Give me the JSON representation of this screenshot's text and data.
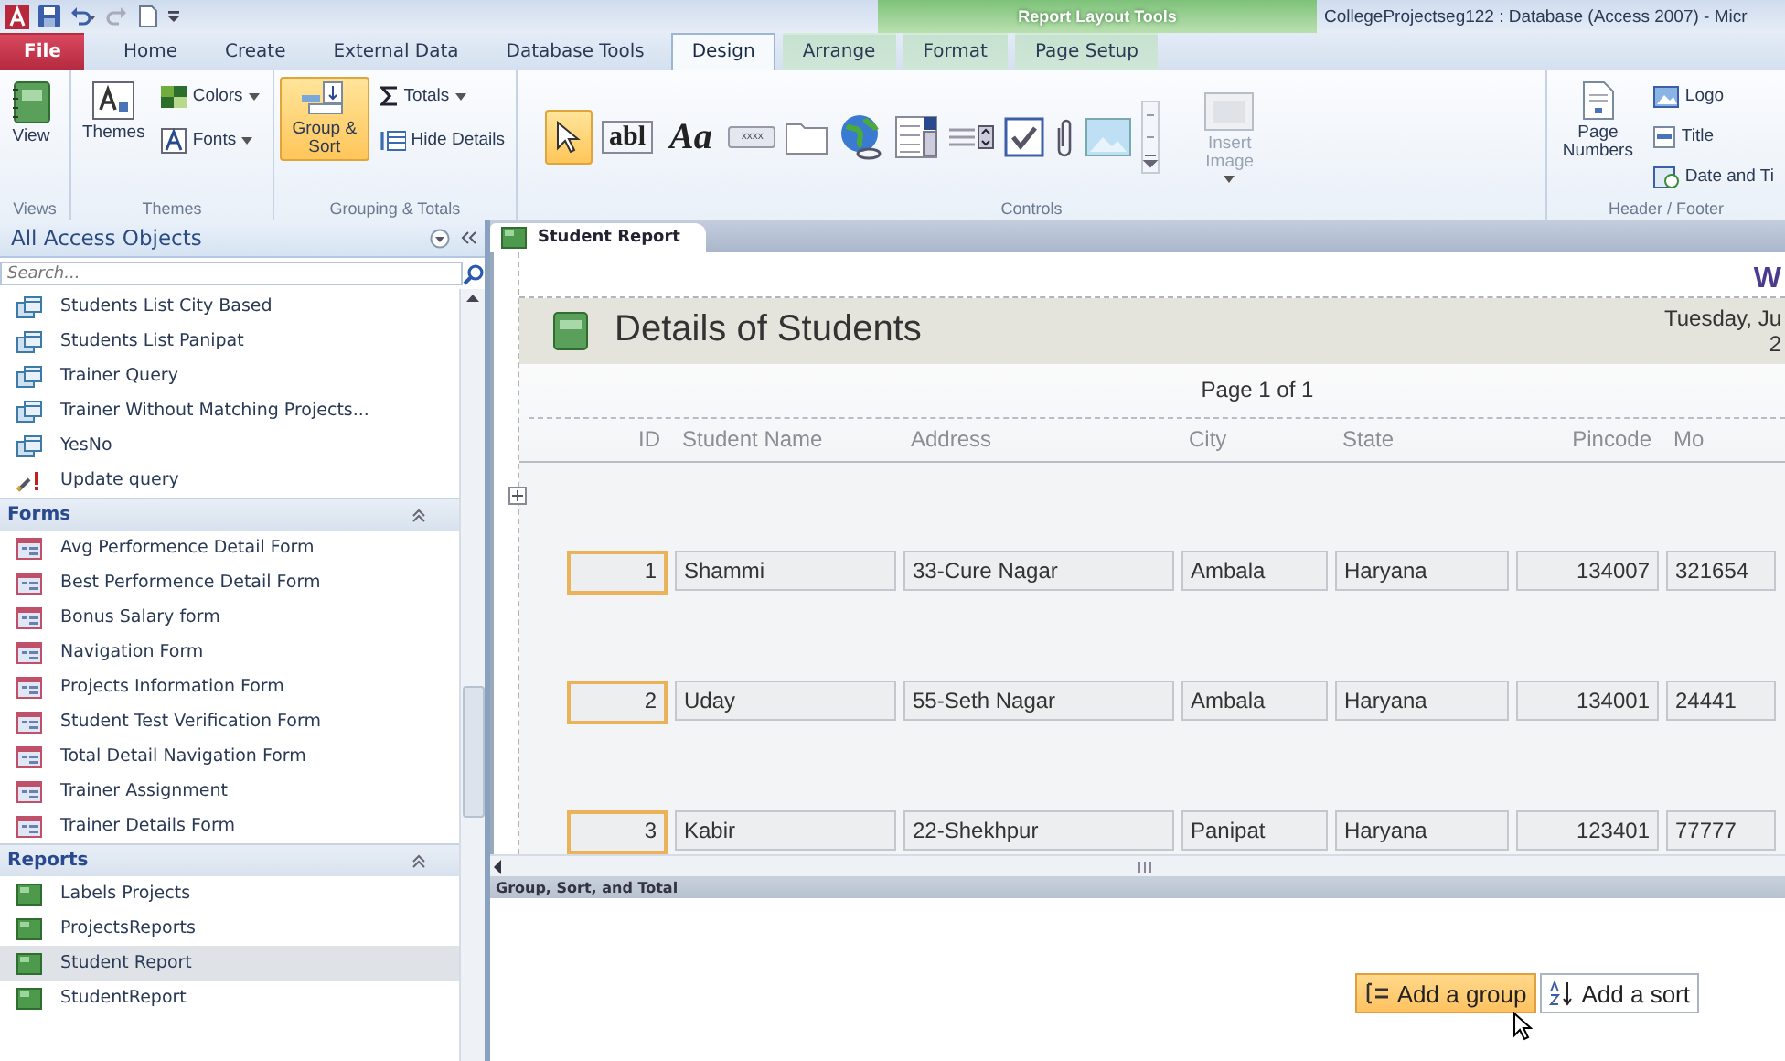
{
  "title_bar": {
    "contextual_group": "Report Layout Tools",
    "title": "CollegeProjectseg122 : Database (Access 2007) - Micr"
  },
  "ribbon_tabs": [
    {
      "label": "File",
      "kind": "file",
      "selected": false
    },
    {
      "label": "Home",
      "kind": "main",
      "selected": false
    },
    {
      "label": "Create",
      "kind": "main",
      "selected": false
    },
    {
      "label": "External Data",
      "kind": "main",
      "selected": false
    },
    {
      "label": "Database Tools",
      "kind": "main",
      "selected": false
    },
    {
      "label": "Design",
      "kind": "contextual",
      "selected": true
    },
    {
      "label": "Arrange",
      "kind": "contextual",
      "selected": false
    },
    {
      "label": "Format",
      "kind": "contextual",
      "selected": false
    },
    {
      "label": "Page Setup",
      "kind": "contextual",
      "selected": false
    }
  ],
  "ribbon": {
    "views": {
      "view_button": "View",
      "group_label": "Views"
    },
    "themes": {
      "themes_button": "Themes",
      "colors_button": "Colors",
      "fonts_button": "Fonts",
      "group_label": "Themes"
    },
    "grouping_totals": {
      "group_sort_button": {
        "label": "Group & Sort",
        "selected": true
      },
      "totals_button": "Totals",
      "hide_details_button": "Hide Details",
      "group_label": "Grouping & Totals"
    },
    "controls": {
      "select_tool_selected": true,
      "text_box_glyph": "abl",
      "label_glyph": "Aa",
      "button_glyph": "xxxx",
      "insert_image": {
        "label": "Insert Image",
        "disabled": true
      },
      "group_label": "Controls"
    },
    "header_footer": {
      "page_numbers_button": "Page Numbers",
      "logo_button": "Logo",
      "title_button": "Title",
      "date_time_button": "Date and Ti",
      "group_label": "Header / Footer"
    }
  },
  "navigation_pane": {
    "title": "All Access Objects",
    "search": {
      "placeholder": "Search..."
    },
    "sections": [
      {
        "items": [
          {
            "label": "Students List City Based",
            "kind": "query",
            "selected": false
          },
          {
            "label": "Students List Panipat",
            "kind": "query",
            "selected": false
          },
          {
            "label": "Trainer Query",
            "kind": "query",
            "selected": false
          },
          {
            "label": "Trainer Without Matching Projects...",
            "kind": "query",
            "selected": false
          },
          {
            "label": "YesNo",
            "kind": "query",
            "selected": false
          },
          {
            "label": "Update query",
            "kind": "update",
            "selected": false
          }
        ]
      },
      {
        "header": "Forms",
        "expanded": true,
        "items": [
          {
            "label": "Avg Performence Detail Form",
            "kind": "form",
            "selected": false
          },
          {
            "label": "Best Performence Detail Form",
            "kind": "form",
            "selected": false
          },
          {
            "label": "Bonus Salary form",
            "kind": "form",
            "selected": false
          },
          {
            "label": "Navigation Form",
            "kind": "form",
            "selected": false
          },
          {
            "label": "Projects Information Form",
            "kind": "form",
            "selected": false
          },
          {
            "label": "Student Test Verification Form",
            "kind": "form",
            "selected": false
          },
          {
            "label": "Total Detail Navigation Form",
            "kind": "form",
            "selected": false
          },
          {
            "label": "Trainer Assignment",
            "kind": "form",
            "selected": false
          },
          {
            "label": "Trainer Details Form",
            "kind": "form",
            "selected": false
          }
        ]
      },
      {
        "header": "Reports",
        "expanded": true,
        "items": [
          {
            "label": "Labels Projects",
            "kind": "report",
            "selected": false
          },
          {
            "label": "ProjectsReports",
            "kind": "report",
            "selected": false
          },
          {
            "label": "Student Report",
            "kind": "report",
            "selected": true
          },
          {
            "label": "StudentReport",
            "kind": "report",
            "selected": false
          }
        ]
      }
    ]
  },
  "document_tab": {
    "label": "Student Report"
  },
  "report": {
    "corner_text": "W",
    "title": "Details of Students",
    "date": "Tuesday, Ju",
    "time": "2",
    "page": "Page 1 of 1",
    "columns": [
      {
        "label": "ID",
        "selected": true
      },
      {
        "label": "Student Name",
        "selected": false
      },
      {
        "label": "Address",
        "selected": false
      },
      {
        "label": "City",
        "selected": false
      },
      {
        "label": "State",
        "selected": false
      },
      {
        "label": "Pincode",
        "selected": false
      },
      {
        "label": "Mo",
        "selected": false
      }
    ],
    "rows": [
      [
        "1",
        "Shammi",
        "33-Cure Nagar",
        "Ambala",
        "Haryana",
        "134007",
        "321654"
      ],
      [
        "2",
        "Uday",
        "55-Seth Nagar",
        "Ambala",
        "Haryana",
        "134001",
        "24441"
      ],
      [
        "3",
        "Kabir",
        "22-Shekhpur",
        "Panipat",
        "Haryana",
        "123401",
        "77777"
      ]
    ]
  },
  "group_sort_pane": {
    "title": "Group, Sort, and Total",
    "add_group_button": {
      "label": "Add a group",
      "highlighted": true
    },
    "add_sort_button": {
      "label": "Add a sort",
      "highlighted": false
    }
  }
}
